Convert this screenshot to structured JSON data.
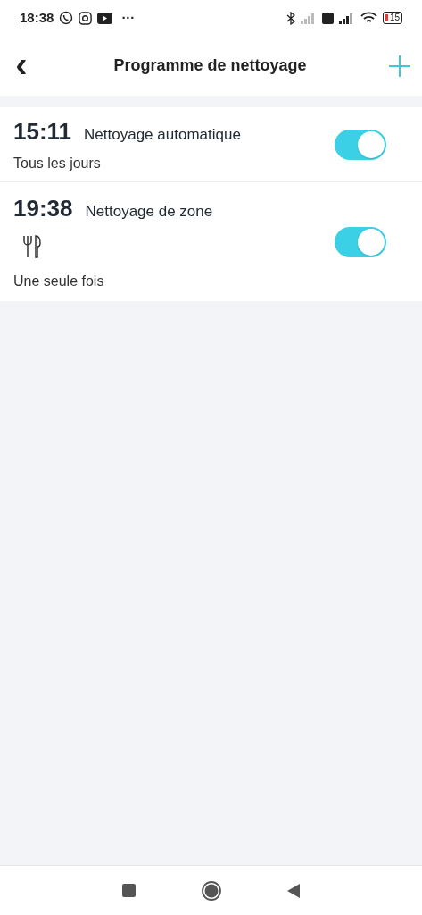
{
  "status_bar": {
    "time": "18:38",
    "more": "···",
    "battery": "15"
  },
  "header": {
    "back": "‹",
    "title": "Programme de nettoyage"
  },
  "schedules": [
    {
      "kind": "full",
      "time": "15:11",
      "name": "Nettoyage automatique",
      "repeat": "Tous les jours",
      "on": true
    },
    {
      "kind": "zone",
      "time": "19:38",
      "name": "Nettoyage de zone",
      "repeat": "Une seule fois",
      "on": true
    }
  ]
}
